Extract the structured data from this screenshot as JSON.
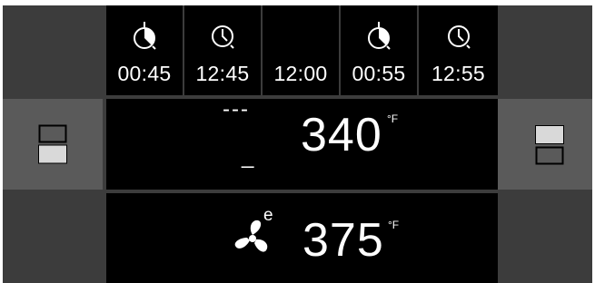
{
  "colors": {
    "panel": "#3c3c3c",
    "side_highlight": "#5a5a5a",
    "display_background": "#000000",
    "text": "#ffffff"
  },
  "timers": [
    {
      "value": "00:45",
      "icon": "countdown-timer-icon"
    },
    {
      "value": "12:45",
      "icon": "clock-icon"
    },
    {
      "value": "12:00",
      "icon": ""
    },
    {
      "value": "00:55",
      "icon": "countdown-timer-icon"
    },
    {
      "value": "12:55",
      "icon": "clock-icon"
    }
  ],
  "upper_oven": {
    "mode_top": "---",
    "mode_bottom": "_",
    "temperature": "340",
    "unit": "°F"
  },
  "lower_oven": {
    "mode_icon": "convection-fan-icon",
    "mode_letter": "e",
    "temperature": "375",
    "unit": "°F"
  },
  "side_buttons": {
    "left": "upper-oven-select-icon",
    "right": "lower-oven-select-icon"
  }
}
